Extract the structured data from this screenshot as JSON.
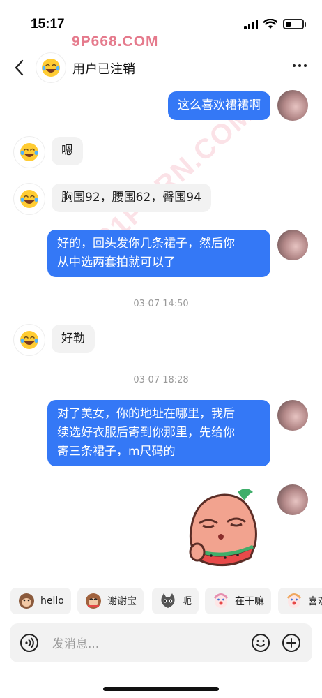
{
  "status_bar": {
    "time": "15:17",
    "battery_level": 0.3
  },
  "watermark": {
    "top_text": "9P668.COM",
    "diagonal_text": "91PORN.COM"
  },
  "header": {
    "title": "用户已注销"
  },
  "messages": [
    {
      "side": "self",
      "text": "这么喜欢裙裙啊"
    },
    {
      "side": "other",
      "text": "嗯"
    },
    {
      "side": "other",
      "text": "胸围92，腰围62，臀围94"
    },
    {
      "side": "self",
      "lines": [
        "好的，回头发你几条裙子，然后你",
        "从中选两套拍就可以了"
      ]
    },
    {
      "side": "other",
      "text": "好勒"
    },
    {
      "side": "self",
      "lines": [
        "对了美女，你的地址在哪里，我后",
        "续选好衣服后寄到你那里，先给你",
        "寄三条裙子，m尺码的"
      ]
    }
  ],
  "timestamps": [
    "03-07 14:50",
    "03-07 18:28"
  ],
  "quick_replies": [
    {
      "label": "hello",
      "icon": "monkey-icon"
    },
    {
      "label": "谢谢宝",
      "icon": "monkey-bow-icon"
    },
    {
      "label": "呃",
      "icon": "cat-icon"
    },
    {
      "label": "在干嘛",
      "icon": "clown-icon"
    },
    {
      "label": "喜欢",
      "icon": "clown-icon"
    }
  ],
  "input": {
    "placeholder": "发消息..."
  },
  "colors": {
    "self_bubble": "#3478f6",
    "other_bubble": "#f2f2f2",
    "background": "#ffffff"
  }
}
